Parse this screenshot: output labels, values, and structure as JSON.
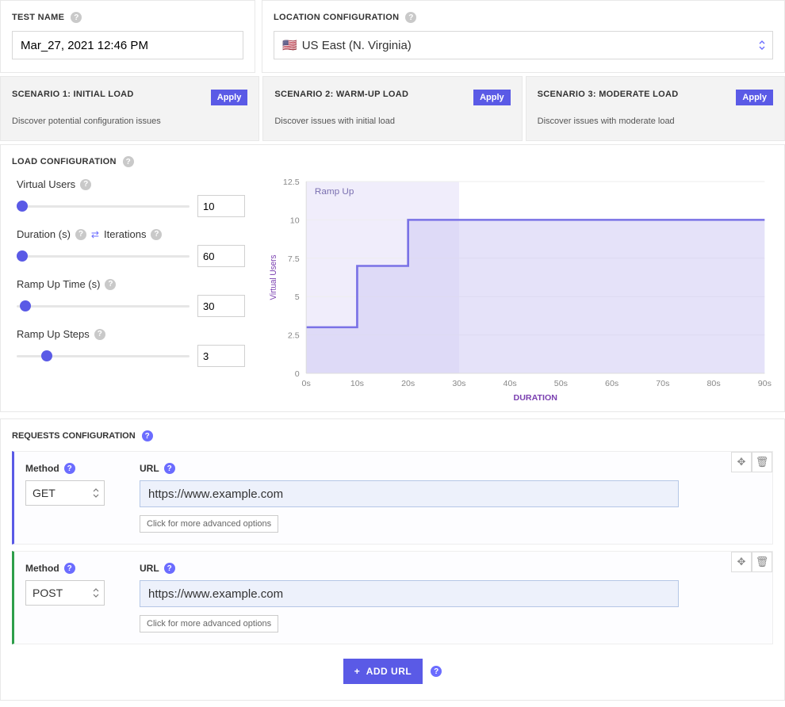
{
  "header": {
    "test_name_label": "TEST NAME",
    "test_name_value": "Mar_27, 2021 12:46 PM",
    "location_label": "LOCATION CONFIGURATION",
    "location_value": "US East (N. Virginia)",
    "location_flag": "🇺🇸"
  },
  "scenarios": [
    {
      "title": "SCENARIO 1: INITIAL LOAD",
      "desc": "Discover potential configuration issues",
      "apply": "Apply"
    },
    {
      "title": "SCENARIO 2: WARM-UP LOAD",
      "desc": "Discover issues with initial load",
      "apply": "Apply"
    },
    {
      "title": "SCENARIO 3: MODERATE LOAD",
      "desc": "Discover issues with moderate load",
      "apply": "Apply"
    }
  ],
  "load": {
    "section_label": "LOAD CONFIGURATION",
    "virtual_users": {
      "label": "Virtual Users",
      "value": "10",
      "pct": 0
    },
    "duration": {
      "label": "Duration (s)",
      "iterations_label": "Iterations",
      "value": "60",
      "pct": 0
    },
    "ramp_time": {
      "label": "Ramp Up Time (s)",
      "value": "30",
      "pct": 2
    },
    "ramp_steps": {
      "label": "Ramp Up Steps",
      "value": "3",
      "pct": 14
    },
    "chart_area_label": "Ramp Up"
  },
  "chart_data": {
    "type": "area",
    "title": "",
    "xlabel": "DURATION",
    "ylabel": "Virtual Users",
    "ylim": [
      0,
      12.5
    ],
    "xlim": [
      0,
      90
    ],
    "yticks": [
      0,
      2.5,
      5,
      7.5,
      10,
      12.5
    ],
    "xticks": [
      "0s",
      "10s",
      "20s",
      "30s",
      "40s",
      "50s",
      "60s",
      "70s",
      "80s",
      "90s"
    ],
    "ramp_region_end_x": 30,
    "series": [
      {
        "name": "Virtual Users",
        "points": [
          {
            "x": 0,
            "y": 3
          },
          {
            "x": 10,
            "y": 3
          },
          {
            "x": 10,
            "y": 7
          },
          {
            "x": 20,
            "y": 7
          },
          {
            "x": 20,
            "y": 10
          },
          {
            "x": 90,
            "y": 10
          }
        ]
      }
    ]
  },
  "requests": {
    "section_label": "REQUESTS CONFIGURATION",
    "method_label": "Method",
    "url_label": "URL",
    "advanced_label": "Click for more advanced options",
    "add_label": "ADD URL",
    "items": [
      {
        "method": "GET",
        "url": "https://www.example.com",
        "accent": "#5a5ae6"
      },
      {
        "method": "POST",
        "url": "https://www.example.com",
        "accent": "#2e9e4a"
      }
    ]
  }
}
